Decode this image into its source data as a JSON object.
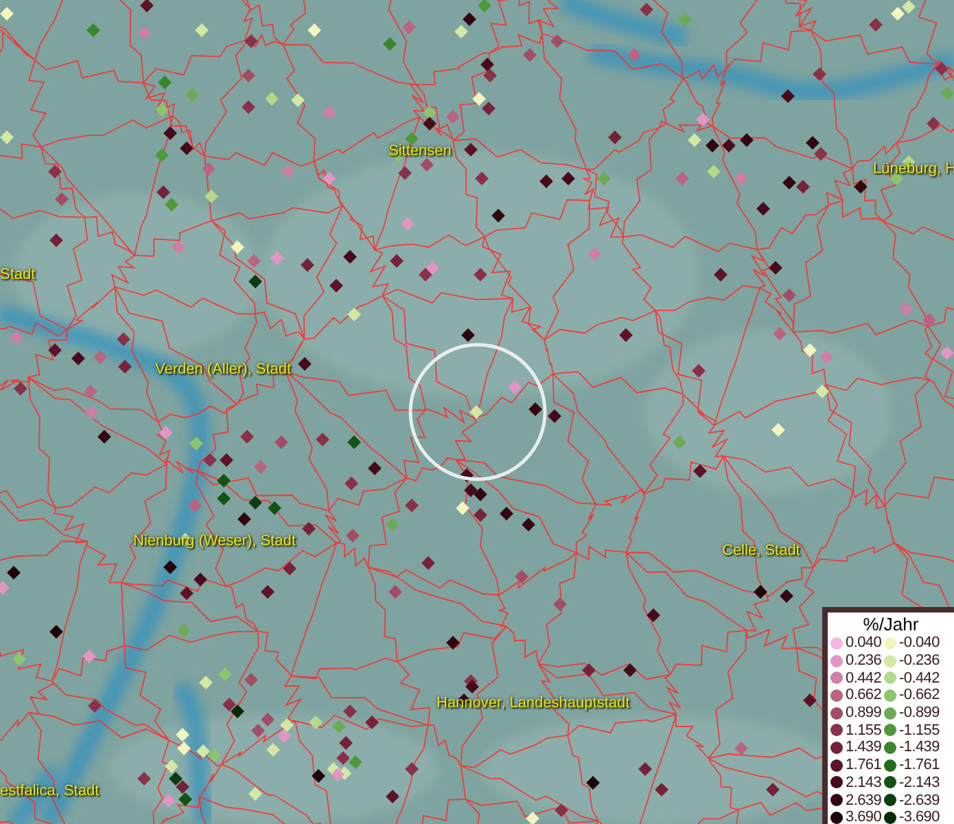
{
  "map": {
    "places": [
      {
        "label": "Sittensen"
      },
      {
        "label": "Lüneburg, H"
      },
      {
        "label": "Stadt"
      },
      {
        "label": "Verden (Aller), Stadt"
      },
      {
        "label": "Nienburg (Weser), Stadt"
      },
      {
        "label": "Celle, Stadt"
      },
      {
        "label": "Hannover, Landeshauptstadt"
      },
      {
        "label": "estfalica, Stadt"
      }
    ]
  },
  "legend": {
    "title": "%/Jahr",
    "columns": [
      {
        "entries": [
          {
            "value": "0.040",
            "color": "#f7b6e4"
          },
          {
            "value": "0.236",
            "color": "#e196c6"
          },
          {
            "value": "0.442",
            "color": "#cf7ea6"
          },
          {
            "value": "0.662",
            "color": "#ba6383"
          },
          {
            "value": "0.899",
            "color": "#a24c66"
          },
          {
            "value": "1.155",
            "color": "#8b3049"
          },
          {
            "value": "1.439",
            "color": "#75213a"
          },
          {
            "value": "1.761",
            "color": "#5d1227"
          },
          {
            "value": "2.143",
            "color": "#470a1a"
          },
          {
            "value": "2.639",
            "color": "#320510"
          },
          {
            "value": "3.690",
            "color": "#1e0208"
          }
        ]
      },
      {
        "entries": [
          {
            "value": "-0.040",
            "color": "#f2f6be"
          },
          {
            "value": "-0.236",
            "color": "#d3e8a4"
          },
          {
            "value": "-0.442",
            "color": "#b5d98a"
          },
          {
            "value": "-0.662",
            "color": "#8fc46f"
          },
          {
            "value": "-0.899",
            "color": "#6caa55"
          },
          {
            "value": "-1.155",
            "color": "#4f993b"
          },
          {
            "value": "-1.439",
            "color": "#3a862d"
          },
          {
            "value": "-1.761",
            "color": "#236a1d"
          },
          {
            "value": "-2.143",
            "color": "#145216"
          },
          {
            "value": "-2.639",
            "color": "#0c3d10"
          },
          {
            "value": "-3.690",
            "color": "#052906"
          }
        ]
      }
    ]
  }
}
